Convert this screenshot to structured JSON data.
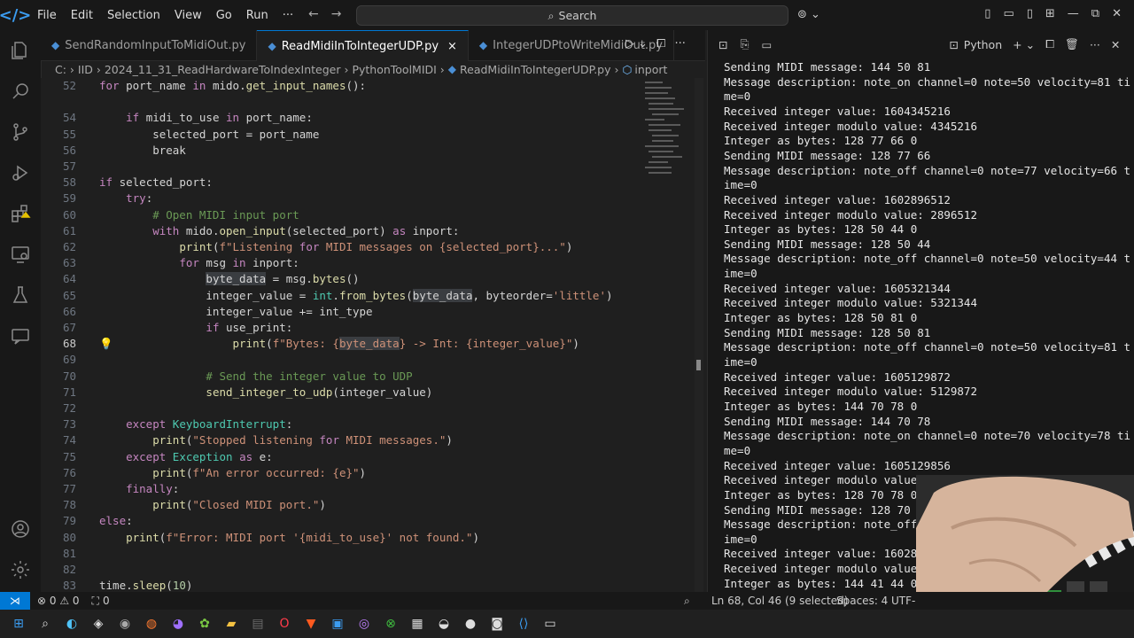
{
  "titlebar": {
    "menu": [
      "File",
      "Edit",
      "Selection",
      "View",
      "Go",
      "Run",
      "···"
    ],
    "search_placeholder": "Search"
  },
  "tabs": [
    {
      "label": "SendRandomInputToMidiOut.py",
      "active": false
    },
    {
      "label": "ReadMidiInToIntegerUDP.py",
      "active": true,
      "close": "×"
    },
    {
      "label": "IntegerUDPtoWriteMidiOut.py",
      "active": false
    }
  ],
  "breadcrumb": [
    "C: › IID › 2024_11_31_ReadHardwareToIndexInteger › PythonToolMIDI › ",
    "ReadMidiInToIntegerUDP.py",
    " › ",
    "inport"
  ],
  "editor": {
    "lines": [
      {
        "n": "52",
        "text": "for port_name in mido.get_input_names():"
      },
      {
        "n": "54",
        "text": "    if midi_to_use in port_name:"
      },
      {
        "n": "55",
        "text": "        selected_port = port_name"
      },
      {
        "n": "56",
        "text": "        break"
      },
      {
        "n": "57",
        "text": ""
      },
      {
        "n": "58",
        "text": "if selected_port:"
      },
      {
        "n": "59",
        "text": "    try:"
      },
      {
        "n": "60",
        "text": "        # Open MIDI input port"
      },
      {
        "n": "61",
        "text": "        with mido.open_input(selected_port) as inport:"
      },
      {
        "n": "62",
        "text": "            print(f\"Listening for MIDI messages on {selected_port}...\")"
      },
      {
        "n": "63",
        "text": "            for msg in inport:"
      },
      {
        "n": "64",
        "text": "                byte_data = msg.bytes()"
      },
      {
        "n": "65",
        "text": "                integer_value = int.from_bytes(byte_data, byteorder='little')"
      },
      {
        "n": "66",
        "text": "                integer_value += int_type"
      },
      {
        "n": "67",
        "text": "                if use_print:"
      },
      {
        "n": "68",
        "text": "                    print(f\"Bytes: {byte_data} -> Int: {integer_value}\")"
      },
      {
        "n": "69",
        "text": ""
      },
      {
        "n": "70",
        "text": "                # Send the integer value to UDP"
      },
      {
        "n": "71",
        "text": "                send_integer_to_udp(integer_value)"
      },
      {
        "n": "72",
        "text": ""
      },
      {
        "n": "73",
        "text": "    except KeyboardInterrupt:"
      },
      {
        "n": "74",
        "text": "        print(\"Stopped listening for MIDI messages.\")"
      },
      {
        "n": "75",
        "text": "    except Exception as e:"
      },
      {
        "n": "76",
        "text": "        print(f\"An error occurred: {e}\")"
      },
      {
        "n": "77",
        "text": "    finally:"
      },
      {
        "n": "78",
        "text": "        print(\"Closed MIDI port.\")"
      },
      {
        "n": "79",
        "text": "else:"
      },
      {
        "n": "80",
        "text": "    print(f\"Error: MIDI port '{midi_to_use}' not found.\")"
      },
      {
        "n": "81",
        "text": ""
      },
      {
        "n": "82",
        "text": ""
      },
      {
        "n": "83",
        "text": "time.sleep(10)"
      }
    ]
  },
  "terminal": {
    "profile": "Python",
    "lines": [
      "Sending MIDI message: 144 50 81",
      "Message description: note_on channel=0 note=50 velocity=81 ti",
      "me=0",
      "Received integer value: 1604345216",
      "Received integer modulo value: 4345216",
      "Integer as bytes: 128 77 66 0",
      "Sending MIDI message: 128 77 66",
      "Message description: note_off channel=0 note=77 velocity=66 t",
      "ime=0",
      "Received integer value: 1602896512",
      "Received integer modulo value: 2896512",
      "Integer as bytes: 128 50 44 0",
      "Sending MIDI message: 128 50 44",
      "Message description: note_off channel=0 note=50 velocity=44 t",
      "ime=0",
      "Received integer value: 1605321344",
      "Received integer modulo value: 5321344",
      "Integer as bytes: 128 50 81 0",
      "Sending MIDI message: 128 50 81",
      "Message description: note_off channel=0 note=50 velocity=81 t",
      "ime=0",
      "Received integer value: 1605129872",
      "Received integer modulo value: 5129872",
      "Integer as bytes: 144 70 78 0",
      "Sending MIDI message: 144 70 78",
      "Message description: note_on channel=0 note=70 velocity=78 ti",
      "me=0",
      "Received integer value: 1605129856",
      "Received integer modulo value:",
      "Integer as bytes: 128 70 78 0",
      "Sending MIDI message: 128 70 7",
      "Message description: note_off",
      "ime=0",
      "Received integer value: 160289",
      "Received integer modulo value:",
      "Integer as bytes: 144 41 44 0"
    ]
  },
  "statusbar": {
    "errors": "⊗ 0 ⚠ 0",
    "ports": "0",
    "position": "Ln 68, Col 46 (9 selected)",
    "spaces": "Spaces: 4",
    "encoding": "UTF-"
  }
}
